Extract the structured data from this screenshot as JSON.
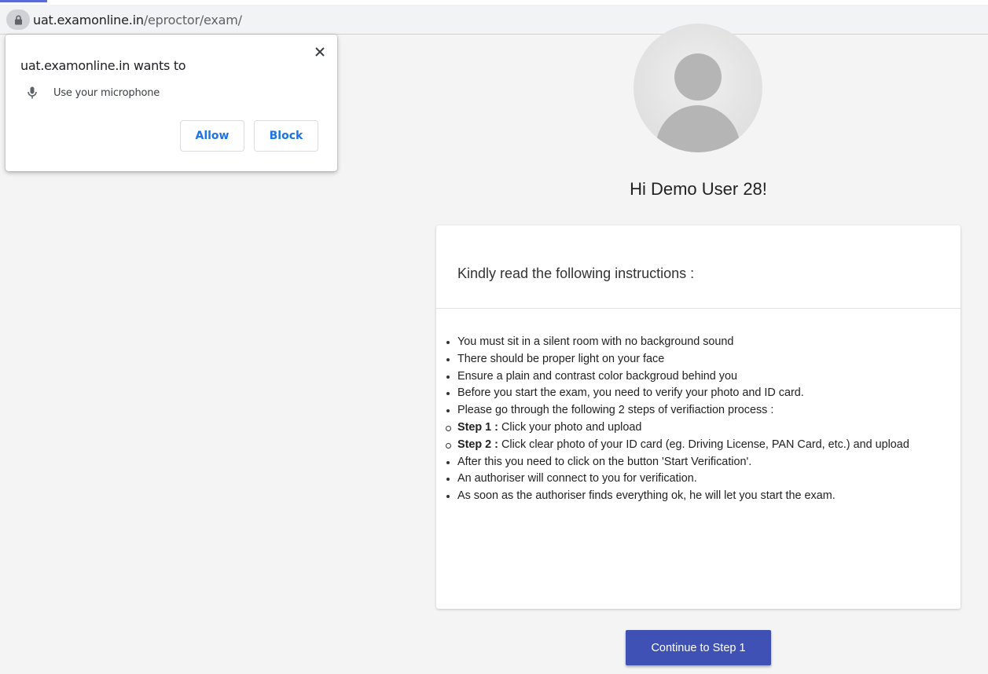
{
  "browser": {
    "url_host": "uat.examonline.in",
    "url_path": "/eproctor/exam/"
  },
  "permission_prompt": {
    "title": "uat.examonline.in wants to",
    "request_label": "Use your microphone",
    "request_icon": "microphone-icon",
    "allow_label": "Allow",
    "block_label": "Block",
    "accent_color": "#1a73e8"
  },
  "page": {
    "greeting": "Hi Demo User 28!",
    "instructions_heading": "Kindly read the following instructions :",
    "instructions": [
      {
        "type": "bullet",
        "bold": "",
        "text": "You must sit in a silent room with no background sound"
      },
      {
        "type": "bullet",
        "bold": "",
        "text": "There should be proper light on your face"
      },
      {
        "type": "bullet",
        "bold": "",
        "text": "Ensure a plain and contrast color backgroud behind you"
      },
      {
        "type": "bullet",
        "bold": "",
        "text": "Before you start the exam, you need to verify your photo and ID card."
      },
      {
        "type": "bullet",
        "bold": "",
        "text": "Please go through the following 2 steps of verifiaction process :"
      },
      {
        "type": "sub",
        "bold": "Step 1 :",
        "text": " Click your photo and upload"
      },
      {
        "type": "sub",
        "bold": "Step 2 :",
        "text": " Click clear photo of your ID card (eg. Driving License, PAN Card, etc.) and upload"
      },
      {
        "type": "bullet",
        "bold": "",
        "text": "After this you need to click on the button 'Start Verification'."
      },
      {
        "type": "bullet",
        "bold": "",
        "text": "An authoriser will connect to you for verification."
      },
      {
        "type": "bullet",
        "bold": "",
        "text": "As soon as the authoriser finds everything ok, he will let you start the exam."
      }
    ],
    "continue_label": "Continue to Step 1",
    "primary_color": "#3f51b5"
  }
}
